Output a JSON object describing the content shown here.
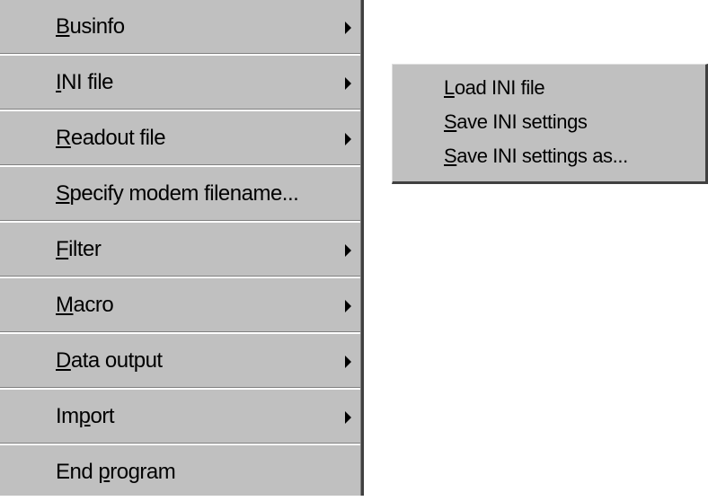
{
  "main_menu": {
    "items": [
      {
        "label_pre": "",
        "mnemonic": "B",
        "label_post": "usinfo",
        "has_submenu": true
      },
      {
        "label_pre": "",
        "mnemonic": "I",
        "label_post": "NI file",
        "has_submenu": true
      },
      {
        "label_pre": "",
        "mnemonic": "R",
        "label_post": "eadout file",
        "has_submenu": true
      },
      {
        "label_pre": "",
        "mnemonic": "S",
        "label_post": "pecify modem filename...",
        "has_submenu": false
      },
      {
        "label_pre": "",
        "mnemonic": "F",
        "label_post": "ilter",
        "has_submenu": true
      },
      {
        "label_pre": "",
        "mnemonic": "M",
        "label_post": "acro",
        "has_submenu": true
      },
      {
        "label_pre": "",
        "mnemonic": "D",
        "label_post": "ata output",
        "has_submenu": true
      },
      {
        "label_pre": "Im",
        "mnemonic": "p",
        "label_post": "ort",
        "has_submenu": true
      },
      {
        "label_pre": "End ",
        "mnemonic": "p",
        "label_post": "rogram",
        "has_submenu": false
      }
    ]
  },
  "submenu": {
    "items": [
      {
        "label_pre": "",
        "mnemonic": "L",
        "label_post": "oad INI file"
      },
      {
        "label_pre": "",
        "mnemonic": "S",
        "label_post": "ave INI settings"
      },
      {
        "label_pre": "",
        "mnemonic": "S",
        "label_post": "ave INI settings as..."
      }
    ]
  },
  "icons": {
    "submenu_arrow": "submenu-arrow-icon"
  },
  "colors": {
    "menu_background": "#c0c0c0",
    "text": "#000000",
    "shadow": "#404040",
    "highlight": "#ffffff"
  }
}
